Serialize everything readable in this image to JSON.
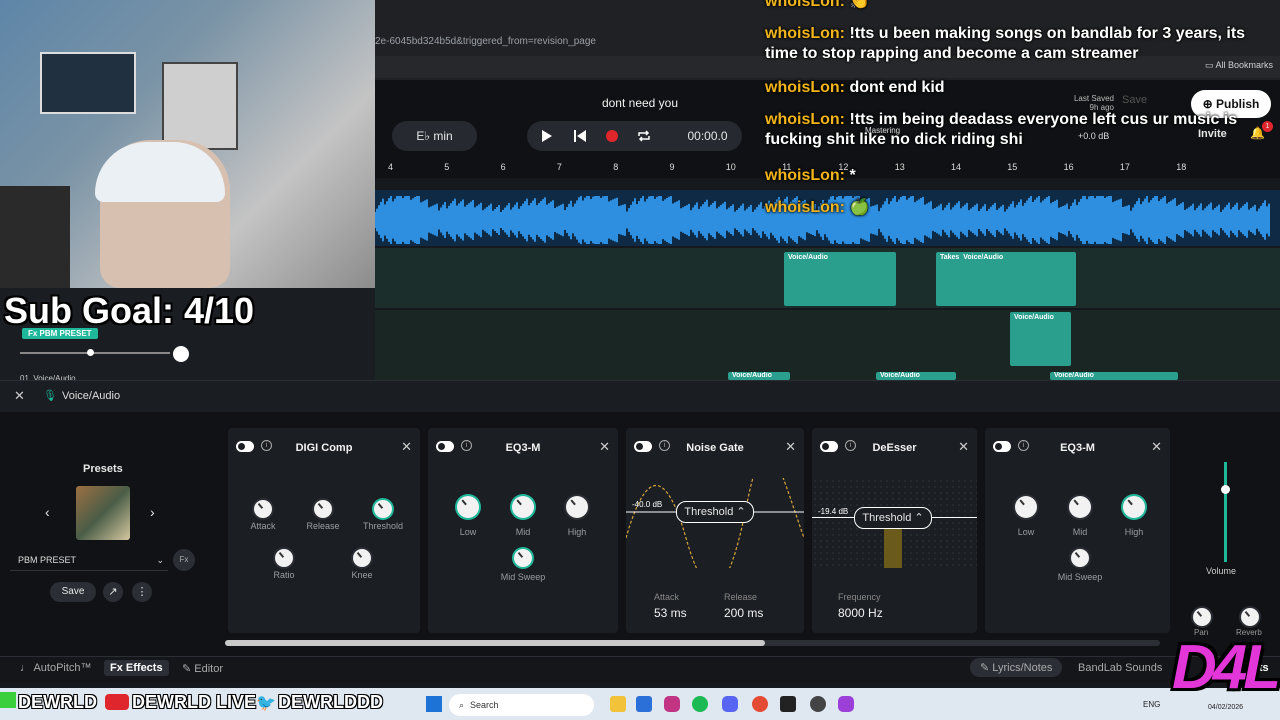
{
  "browser": {
    "url": "2e-6045bd324b5d&triggered_from=revision_page",
    "all_bookmarks": "All Bookmarks"
  },
  "daw": {
    "song_title": "dont need you",
    "key": "E♭ min",
    "time": "00:00.0",
    "last_saved": "Last Saved",
    "last_saved_ago": "9h ago",
    "save": "Save",
    "publish": "Publish",
    "invite": "Invite",
    "notification_count": "1",
    "mastering": "Mastering",
    "master_db": "+0.0 dB",
    "ruler": [
      "4",
      "5",
      "6",
      "7",
      "8",
      "9",
      "10",
      "11",
      "12",
      "13",
      "14",
      "15",
      "16",
      "17",
      "18"
    ]
  },
  "clips": [
    {
      "label": "Voice/Audio"
    },
    {
      "label": "Voice/Audio",
      "takes": "Takes"
    },
    {
      "label": "Voice/Audio"
    },
    {
      "label": "Voice/Audio"
    },
    {
      "label": "Voice/Audio"
    },
    {
      "label": "Voice/Audio"
    }
  ],
  "chat": [
    {
      "user": "whoisLon:",
      "msg": "👏"
    },
    {
      "user": "whoisLon:",
      "msg": "!tts u been making songs on bandlab for 3 years, its time to stop rapping and become a cam streamer"
    },
    {
      "user": "whoisLon:",
      "msg": "dont end kid"
    },
    {
      "user": "whoisLon:",
      "msg": "!tts im being deadass everyone left cus ur music is fucking shit like no dick riding shi"
    },
    {
      "user": "whoisLon:",
      "msg": "*"
    },
    {
      "user": "whoisLon:",
      "msg": "🍏"
    }
  ],
  "overlay": {
    "sub_goal": "Sub Goal: 4/10",
    "fx_badge": "Fx PBM PRESET",
    "track_name": "01. Voice/Audio",
    "d4l": "D4L",
    "socials": [
      {
        "handle": "DEWRLD"
      },
      {
        "handle": "DEWRLD LIVE"
      },
      {
        "handle": "DEWRLDDD"
      }
    ]
  },
  "panel": {
    "title": "Voice/Audio",
    "presets_title": "Presets",
    "preset_name": "PBM PRESET",
    "save": "Save"
  },
  "effects": [
    {
      "name": "DIGI Comp",
      "knobs": [
        "Attack",
        "Release",
        "Threshold",
        "Ratio",
        "Knee"
      ]
    },
    {
      "name": "EQ3-M",
      "knobs": [
        "Low",
        "Mid",
        "High",
        "Mid Sweep"
      ]
    },
    {
      "name": "Noise Gate",
      "threshold_db": "-40.0 dB",
      "threshold_label": "Threshold",
      "attack_label": "Attack",
      "attack": "53 ms",
      "release_label": "Release",
      "release": "200 ms"
    },
    {
      "name": "DeEsser",
      "threshold_db": "-19.4 dB",
      "threshold_label": "Threshold",
      "frequency_label": "Frequency",
      "frequency": "8000 Hz"
    },
    {
      "name": "EQ3-M",
      "knobs": [
        "Low",
        "Mid",
        "High",
        "Mid Sweep"
      ]
    }
  ],
  "right_panel": {
    "volume": "Volume",
    "pan": "Pan",
    "reverb": "Reverb"
  },
  "bottom_tabs": {
    "autopitch": "AutoPitch™",
    "effects": "Effects",
    "editor": "Editor",
    "lyrics": "Lyrics/Notes",
    "sounds": "BandLab Sounds",
    "cuts": "cuts"
  },
  "taskbar": {
    "search": "Search",
    "lang": "ENG",
    "date": "04/02/2026"
  },
  "colors": {
    "accent": "#1fb89a",
    "master_wave": "#2e8fe0",
    "clip": "#2a9f8e",
    "chat_user": "#f2b51a",
    "d4l": "#e336d8"
  }
}
